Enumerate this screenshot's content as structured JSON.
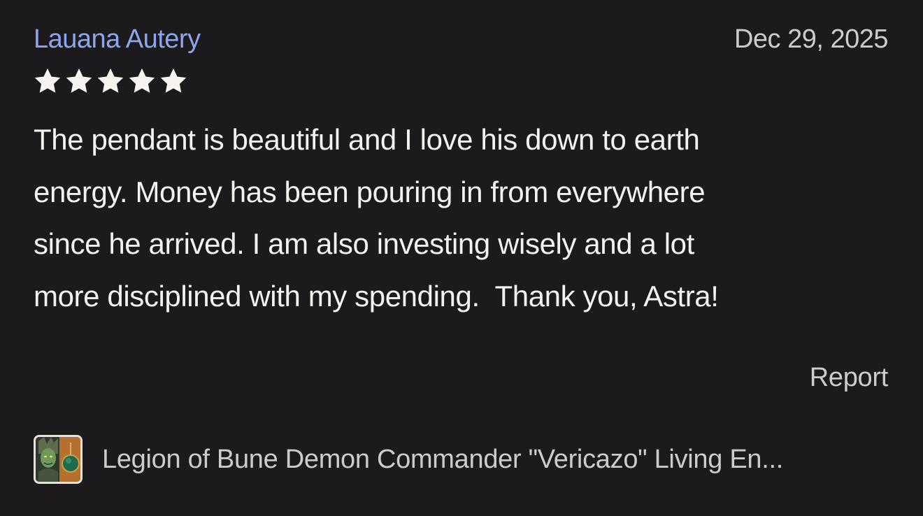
{
  "review": {
    "reviewer_name": "Lauana Autery",
    "date": "Dec 29, 2025",
    "rating": 5,
    "rating_max": 5,
    "text": "The pendant is beautiful and I love his down to earth\nenergy. Money has been pouring in from everywhere\nsince he arrived. I am also investing wisely and a lot\nmore disciplined with my spending.  Thank you, Astra!",
    "report_label": "Report"
  },
  "listing": {
    "title": "Legion of Bune Demon Commander \"Vericazo\" Living En..."
  },
  "colors": {
    "background": "#1c1a1d",
    "reviewer_name": "#8da6eb",
    "star": "#f7f4ef",
    "muted_text": "#cfcacd",
    "body_text": "#f4f2f0"
  },
  "icons": {
    "star": "star-icon",
    "thumbnail": "listing-thumbnail"
  }
}
